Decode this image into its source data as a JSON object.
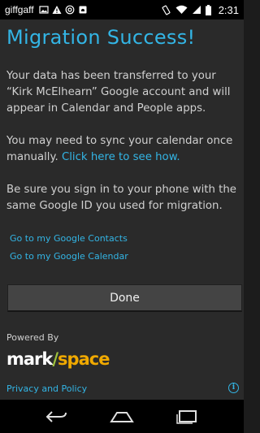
{
  "status_bar": {
    "carrier": "giffgaff",
    "time": "2:31",
    "icons": [
      "image-icon",
      "warning-icon",
      "at-icon",
      "android-icon",
      "vibrate-icon",
      "wifi-icon",
      "signal-icon",
      "battery-icon"
    ]
  },
  "main": {
    "title": "Migration Success!",
    "para1": "Your data has been transferred to your “Kirk McElhearn” Google account and will appear in Calendar and People apps.",
    "para2_text": "You may need to sync your calendar once manually.",
    "para2_link": "Click here to see how.",
    "para3": "Be sure you sign in to your phone with the same Google ID you used for migration.",
    "link_contacts": "Go to my Google Contacts",
    "link_calendar": "Go to my Google Calendar",
    "done_label": "Done",
    "powered_by": "Powered By",
    "logo_mark": "mark",
    "logo_slash": "/",
    "logo_space": "space",
    "privacy_link": "Privacy and Policy",
    "info_glyph": "i"
  },
  "colors": {
    "accent": "#33b5e5",
    "background": "#2a2a2a",
    "button": "#444444"
  },
  "nav_bar": {
    "icons": [
      "back-icon",
      "home-icon",
      "recents-icon"
    ]
  }
}
